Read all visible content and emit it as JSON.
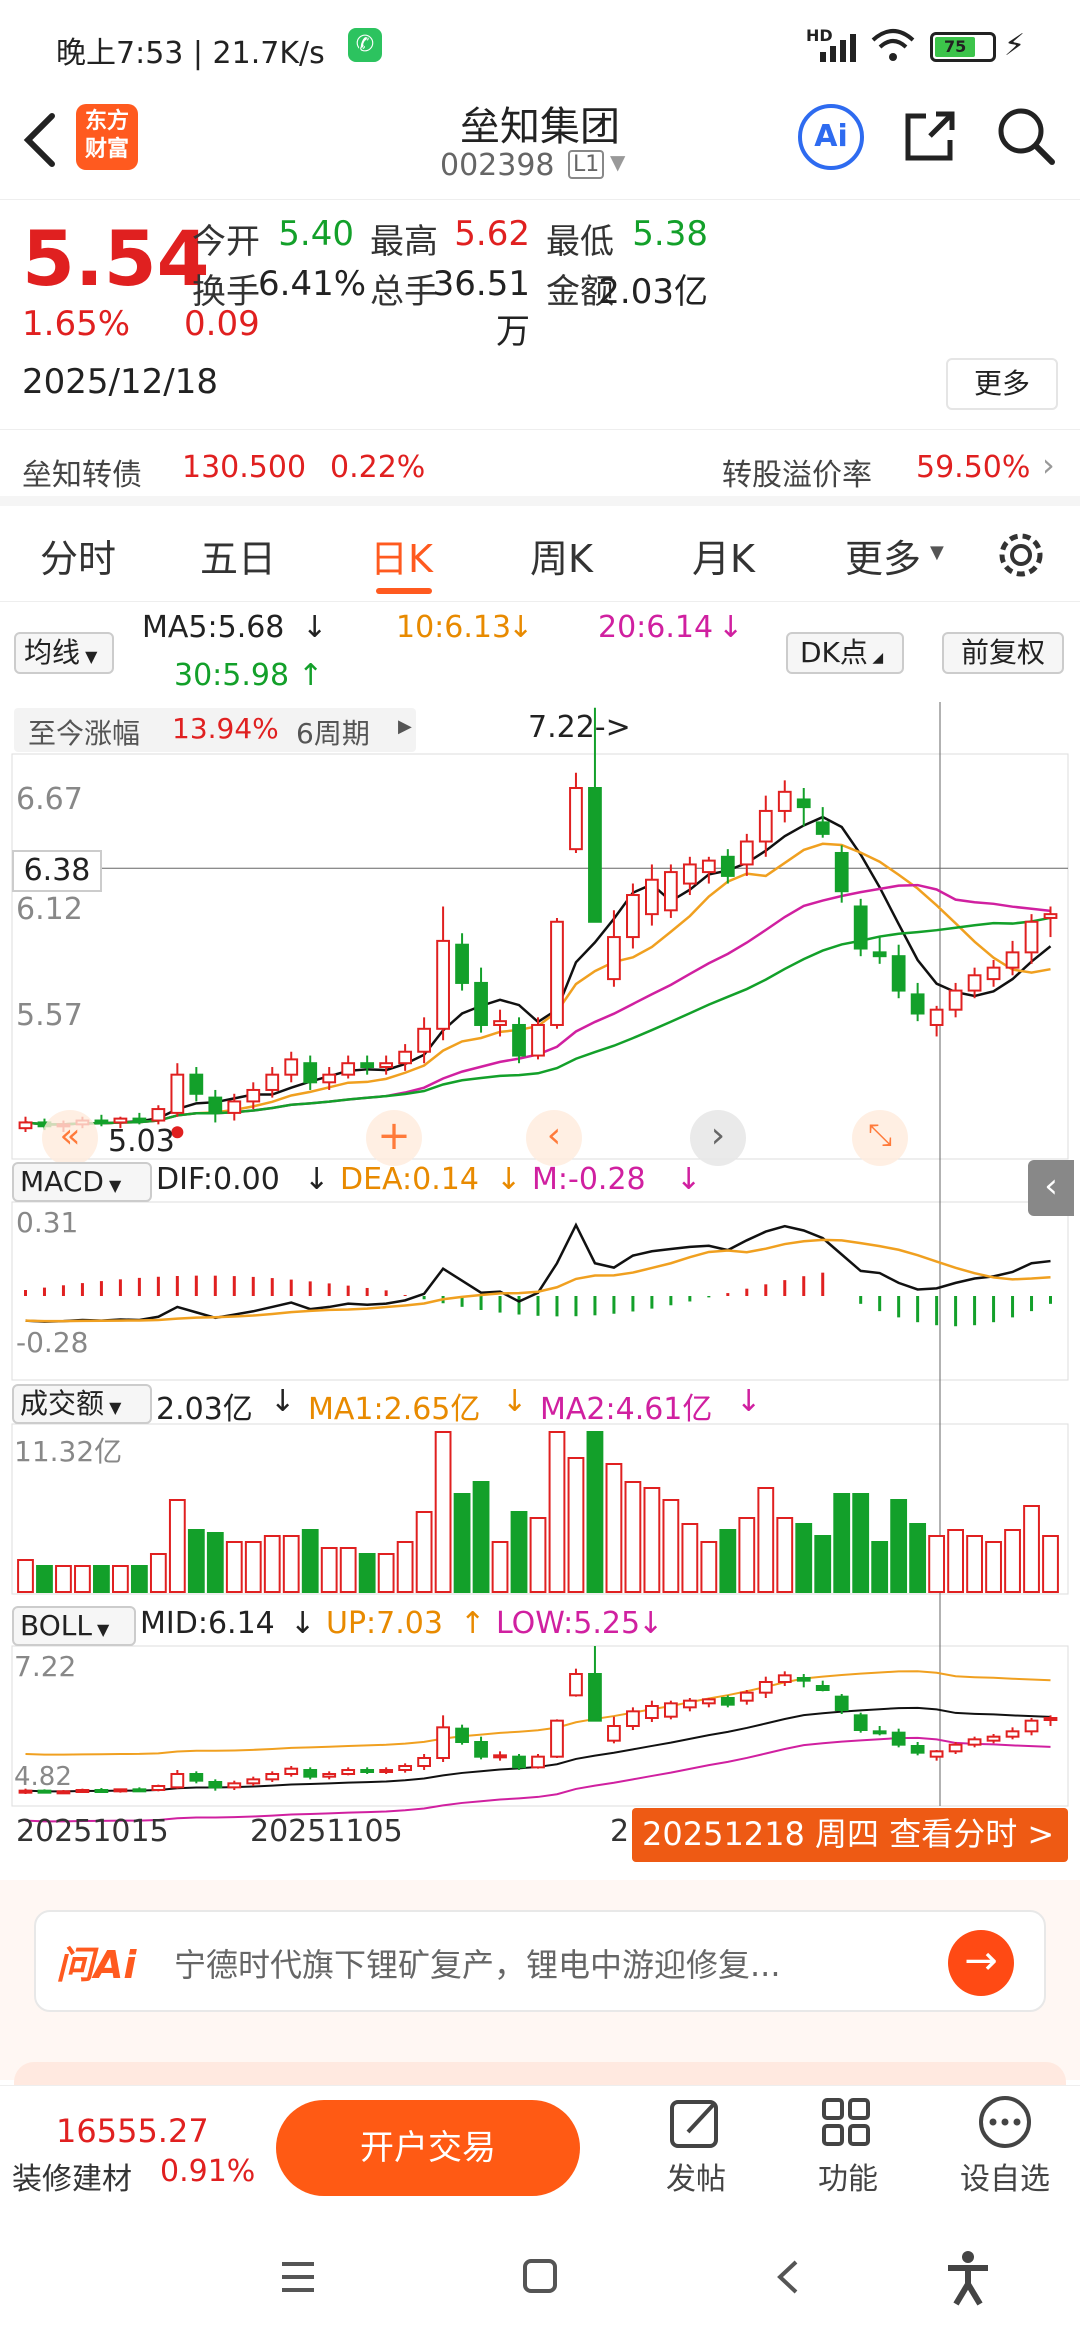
{
  "status": {
    "time": "晚上7:53 | 21.7K/s",
    "battery": "75",
    "signal": "HD"
  },
  "header": {
    "logo_line1": "东方",
    "logo_line2": "财富",
    "name": "垒知集团",
    "code": "002398",
    "level": "L1",
    "ai": "Ai"
  },
  "quote": {
    "price": "5.54",
    "change_pct": "1.65%",
    "change": "0.09",
    "date": "2025/12/18",
    "stats": [
      {
        "label": "今开",
        "value": "5.40",
        "color": "#13a02a"
      },
      {
        "label": "最高",
        "value": "5.62",
        "color": "#e02020"
      },
      {
        "label": "最低",
        "value": "5.38",
        "color": "#13a02a"
      },
      {
        "label": "换手",
        "value": "6.41%",
        "color": "#222222"
      },
      {
        "label": "总手",
        "value": "36.51万",
        "color": "#222222"
      },
      {
        "label": "金额",
        "value": "2.03亿",
        "color": "#222222"
      }
    ],
    "more": "更多"
  },
  "bond": {
    "name": "垒知转债",
    "price": "130.500",
    "pct": "0.22%",
    "premium_label": "转股溢价率",
    "premium": "59.50%"
  },
  "tabs": [
    "分时",
    "五日",
    "日K",
    "周K",
    "月K",
    "更多"
  ],
  "active_tab": 2,
  "ma": {
    "selector": "均线",
    "ma5": "MA5:5.68",
    "ma10": "10:6.13",
    "ma20": "20:6.14",
    "ma30": "30:5.98",
    "dk": "DK点",
    "adjust": "前复权"
  },
  "range": {
    "label": "至今涨幅",
    "value": "13.94%",
    "period": "6周期"
  },
  "price_axis": {
    "top": "6.67",
    "crosshair": "6.38",
    "mid": "6.12",
    "low": "5.57",
    "min_label": "5.03",
    "peak_label": "7.22->"
  },
  "macd": {
    "selector": "MACD",
    "dif": "DIF:0.00",
    "dea": "DEA:0.14",
    "m": "M:-0.28",
    "top": "0.31",
    "bottom": "-0.28"
  },
  "volume": {
    "selector": "成交额",
    "value": "2.03亿",
    "ma1": "MA1:2.65亿",
    "ma2": "MA2:4.61亿",
    "top": "11.32亿"
  },
  "boll": {
    "selector": "BOLL",
    "mid": "MID:6.14",
    "up": "UP:7.03",
    "low": "LOW:5.25",
    "top": "7.22",
    "bottom": "4.82"
  },
  "dates": {
    "d1": "20251015",
    "d2": "20251105",
    "d3": "2",
    "tooltip": "20251218 周四  查看分时 >"
  },
  "ask": {
    "logo": "问Ai",
    "text": "宁德时代旗下锂矿复产，锂电中游迎修复..."
  },
  "bottom": {
    "index_value": "16555.27",
    "sector": "装修建材",
    "sector_pct": "0.91%",
    "trade": "开户交易",
    "post": "发帖",
    "func": "功能",
    "watch": "设自选"
  },
  "colors": {
    "up": "#e02020",
    "down": "#13a02a",
    "accent": "#ff5a1f"
  },
  "chart_data": {
    "type": "candlestick",
    "candles": [
      {
        "o": 5.02,
        "h": 5.08,
        "l": 5.0,
        "c": 5.05
      },
      {
        "o": 5.05,
        "h": 5.07,
        "l": 5.01,
        "c": 5.03
      },
      {
        "o": 5.03,
        "h": 5.06,
        "l": 5.0,
        "c": 5.04
      },
      {
        "o": 5.04,
        "h": 5.08,
        "l": 5.02,
        "c": 5.06
      },
      {
        "o": 5.06,
        "h": 5.09,
        "l": 5.03,
        "c": 5.05
      },
      {
        "o": 5.05,
        "h": 5.08,
        "l": 5.02,
        "c": 5.07
      },
      {
        "o": 5.07,
        "h": 5.1,
        "l": 5.04,
        "c": 5.06
      },
      {
        "o": 5.06,
        "h": 5.14,
        "l": 5.04,
        "c": 5.12
      },
      {
        "o": 5.1,
        "h": 5.36,
        "l": 5.08,
        "c": 5.3
      },
      {
        "o": 5.3,
        "h": 5.34,
        "l": 5.16,
        "c": 5.2
      },
      {
        "o": 5.18,
        "h": 5.22,
        "l": 5.05,
        "c": 5.1
      },
      {
        "o": 5.1,
        "h": 5.2,
        "l": 5.06,
        "c": 5.16
      },
      {
        "o": 5.16,
        "h": 5.26,
        "l": 5.12,
        "c": 5.22
      },
      {
        "o": 5.22,
        "h": 5.34,
        "l": 5.18,
        "c": 5.3
      },
      {
        "o": 5.3,
        "h": 5.42,
        "l": 5.26,
        "c": 5.38
      },
      {
        "o": 5.36,
        "h": 5.4,
        "l": 5.22,
        "c": 5.26
      },
      {
        "o": 5.26,
        "h": 5.34,
        "l": 5.22,
        "c": 5.3
      },
      {
        "o": 5.3,
        "h": 5.4,
        "l": 5.28,
        "c": 5.36
      },
      {
        "o": 5.36,
        "h": 5.4,
        "l": 5.3,
        "c": 5.34
      },
      {
        "o": 5.34,
        "h": 5.4,
        "l": 5.3,
        "c": 5.36
      },
      {
        "o": 5.36,
        "h": 5.46,
        "l": 5.32,
        "c": 5.42
      },
      {
        "o": 5.42,
        "h": 5.6,
        "l": 5.36,
        "c": 5.54
      },
      {
        "o": 5.54,
        "h": 6.18,
        "l": 5.48,
        "c": 6.0
      },
      {
        "o": 5.98,
        "h": 6.04,
        "l": 5.74,
        "c": 5.78
      },
      {
        "o": 5.78,
        "h": 5.86,
        "l": 5.52,
        "c": 5.56
      },
      {
        "o": 5.56,
        "h": 5.64,
        "l": 5.5,
        "c": 5.58
      },
      {
        "o": 5.56,
        "h": 5.6,
        "l": 5.36,
        "c": 5.4
      },
      {
        "o": 5.4,
        "h": 5.6,
        "l": 5.38,
        "c": 5.56
      },
      {
        "o": 5.56,
        "h": 6.12,
        "l": 5.54,
        "c": 6.1
      },
      {
        "o": 6.48,
        "h": 6.88,
        "l": 6.46,
        "c": 6.8
      },
      {
        "o": 6.8,
        "h": 7.22,
        "l": 6.1,
        "c": 6.1
      },
      {
        "o": 5.8,
        "h": 6.16,
        "l": 5.76,
        "c": 6.02
      },
      {
        "o": 6.02,
        "h": 6.3,
        "l": 5.96,
        "c": 6.24
      },
      {
        "o": 6.14,
        "h": 6.4,
        "l": 6.08,
        "c": 6.32
      },
      {
        "o": 6.16,
        "h": 6.4,
        "l": 6.12,
        "c": 6.36
      },
      {
        "o": 6.3,
        "h": 6.44,
        "l": 6.24,
        "c": 6.4
      },
      {
        "o": 6.36,
        "h": 6.44,
        "l": 6.3,
        "c": 6.42
      },
      {
        "o": 6.44,
        "h": 6.48,
        "l": 6.3,
        "c": 6.34
      },
      {
        "o": 6.4,
        "h": 6.56,
        "l": 6.34,
        "c": 6.52
      },
      {
        "o": 6.52,
        "h": 6.76,
        "l": 6.44,
        "c": 6.68
      },
      {
        "o": 6.68,
        "h": 6.84,
        "l": 6.62,
        "c": 6.78
      },
      {
        "o": 6.74,
        "h": 6.8,
        "l": 6.6,
        "c": 6.7
      },
      {
        "o": 6.62,
        "h": 6.7,
        "l": 6.54,
        "c": 6.56
      },
      {
        "o": 6.46,
        "h": 6.5,
        "l": 6.2,
        "c": 6.26
      },
      {
        "o": 6.18,
        "h": 6.22,
        "l": 5.92,
        "c": 5.96
      },
      {
        "o": 5.94,
        "h": 6.02,
        "l": 5.88,
        "c": 5.92
      },
      {
        "o": 5.92,
        "h": 5.98,
        "l": 5.7,
        "c": 5.74
      },
      {
        "o": 5.72,
        "h": 5.78,
        "l": 5.58,
        "c": 5.62
      },
      {
        "o": 5.56,
        "h": 5.66,
        "l": 5.5,
        "c": 5.64
      },
      {
        "o": 5.64,
        "h": 5.78,
        "l": 5.6,
        "c": 5.74
      },
      {
        "o": 5.74,
        "h": 5.86,
        "l": 5.7,
        "c": 5.82
      },
      {
        "o": 5.8,
        "h": 5.9,
        "l": 5.76,
        "c": 5.86
      },
      {
        "o": 5.86,
        "h": 6.0,
        "l": 5.82,
        "c": 5.94
      },
      {
        "o": 5.94,
        "h": 6.14,
        "l": 5.88,
        "c": 6.1
      },
      {
        "o": 6.12,
        "h": 6.18,
        "l": 6.02,
        "c": 6.14
      }
    ],
    "ylim": [
      5.0,
      7.25
    ]
  }
}
